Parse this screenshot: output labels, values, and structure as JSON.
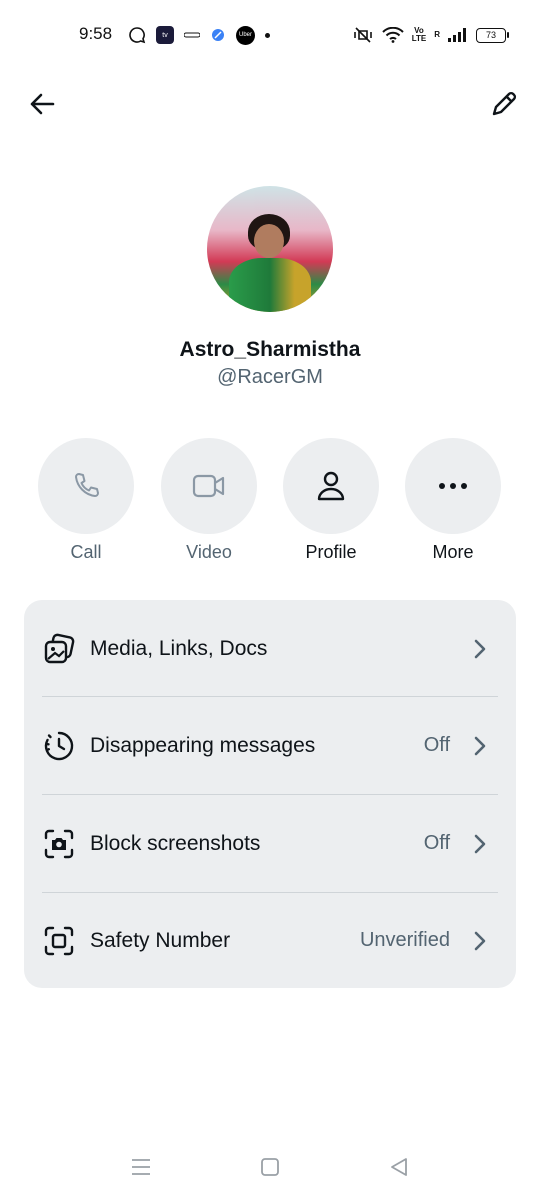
{
  "status_bar": {
    "time": "9:58",
    "tv_badge": "tv",
    "uber_badge": "Uber",
    "volte": "Vo\nLTE",
    "roaming": "R",
    "battery": "73"
  },
  "header": {
    "back_icon": "arrow-left-icon",
    "edit_icon": "pencil-icon"
  },
  "profile": {
    "name": "Astro_Sharmistha",
    "handle": "@RacerGM"
  },
  "actions": [
    {
      "label": "Call",
      "icon": "phone-icon",
      "enabled": false
    },
    {
      "label": "Video",
      "icon": "video-icon",
      "enabled": false
    },
    {
      "label": "Profile",
      "icon": "person-icon",
      "enabled": true
    },
    {
      "label": "More",
      "icon": "more-horizontal-icon",
      "enabled": true
    }
  ],
  "settings": [
    {
      "label": "Media, Links, Docs",
      "value": "",
      "icon": "media-gallery-icon"
    },
    {
      "label": "Disappearing messages",
      "value": "Off",
      "icon": "timer-icon"
    },
    {
      "label": "Block screenshots",
      "value": "Off",
      "icon": "camera-frame-icon"
    },
    {
      "label": "Safety Number",
      "value": "Unverified",
      "icon": "safety-frame-icon"
    }
  ],
  "colors": {
    "text_primary": "#0f1419",
    "text_secondary": "#536471",
    "card_bg": "#eceef0"
  }
}
